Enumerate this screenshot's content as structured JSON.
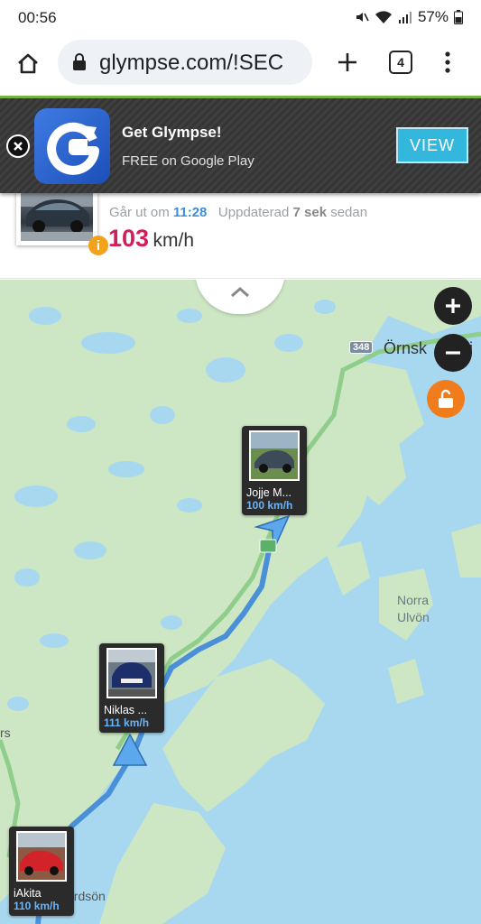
{
  "status_bar": {
    "time": "00:56",
    "battery": "57%"
  },
  "browser": {
    "url": "glympse.com/!SEC",
    "tab_count": "4"
  },
  "ad": {
    "title": "Get Glympse!",
    "subtitle": "FREE on Google Play",
    "button": "VIEW"
  },
  "card": {
    "eta_prefix": "Går ut om",
    "eta_time": "11:28",
    "updated_prefix": "Uppdaterad",
    "updated_value": "7 sek",
    "updated_suffix": "sedan",
    "speed": "103",
    "speed_unit": "km/h",
    "info_glyph": "i"
  },
  "map": {
    "road_shield": "348",
    "place_ornskoldsvik": "Örnsk",
    "place_ornskoldsvik_tail": "vi",
    "place_norra_ulvon_1": "Norra",
    "place_norra_ulvon_2": "Ulvön",
    "place_rs": "rs",
    "place_ordson": "ordsön",
    "markers": [
      {
        "name": "Jojje M...",
        "speed": "100 km/h"
      },
      {
        "name": "Niklas ...",
        "speed": "111 km/h"
      },
      {
        "name": "iAkita",
        "speed": "110 km/h"
      }
    ]
  },
  "colors": {
    "accent_green": "#7ab648",
    "speed_pink": "#d21f5a",
    "ad_button": "#33b7dd",
    "lock_orange": "#f07c1c",
    "water": "#a8d8f0",
    "land": "#cde6c4"
  }
}
